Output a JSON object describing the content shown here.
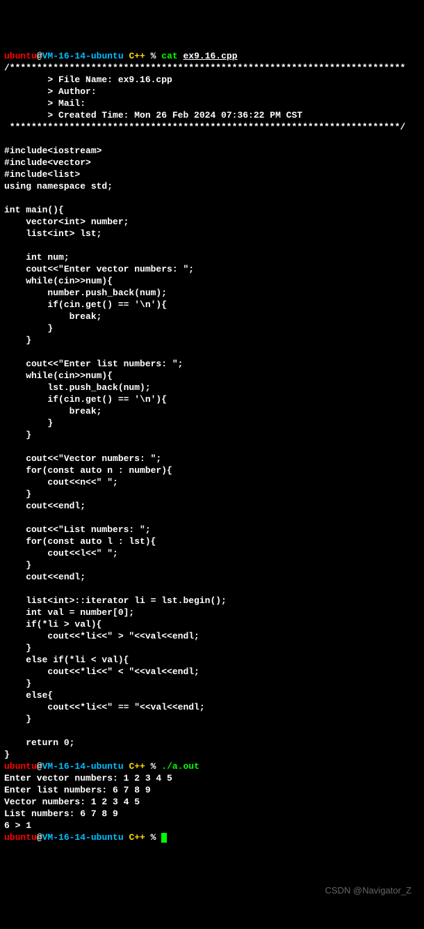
{
  "prompt1": {
    "user": "ubuntu",
    "at": "@",
    "host": "VM-16-14-ubuntu",
    "dir": " C++ ",
    "sym": "% ",
    "cmd": "cat ",
    "arg": "ex9.16.cpp"
  },
  "code": {
    "l01": "/*************************************************************************",
    "l02": "        > File Name: ex9.16.cpp",
    "l03": "        > Author:",
    "l04": "        > Mail:",
    "l05": "        > Created Time: Mon 26 Feb 2024 07:36:22 PM CST",
    "l06": " ************************************************************************/",
    "l07": "",
    "l08": "#include<iostream>",
    "l09": "#include<vector>",
    "l10": "#include<list>",
    "l11": "using namespace std;",
    "l12": "",
    "l13": "int main(){",
    "l14": "    vector<int> number;",
    "l15": "    list<int> lst;",
    "l16": "",
    "l17": "    int num;",
    "l18": "    cout<<\"Enter vector numbers: \";",
    "l19": "    while(cin>>num){",
    "l20": "        number.push_back(num);",
    "l21": "        if(cin.get() == '\\n'){",
    "l22": "            break;",
    "l23": "        }",
    "l24": "    }",
    "l25": "",
    "l26": "    cout<<\"Enter list numbers: \";",
    "l27": "    while(cin>>num){",
    "l28": "        lst.push_back(num);",
    "l29": "        if(cin.get() == '\\n'){",
    "l30": "            break;",
    "l31": "        }",
    "l32": "    }",
    "l33": "",
    "l34": "    cout<<\"Vector numbers: \";",
    "l35": "    for(const auto n : number){",
    "l36": "        cout<<n<<\" \";",
    "l37": "    }",
    "l38": "    cout<<endl;",
    "l39": "",
    "l40": "    cout<<\"List numbers: \";",
    "l41": "    for(const auto l : lst){",
    "l42": "        cout<<l<<\" \";",
    "l43": "    }",
    "l44": "    cout<<endl;",
    "l45": "",
    "l46": "    list<int>::iterator li = lst.begin();",
    "l47": "    int val = number[0];",
    "l48": "    if(*li > val){",
    "l49": "        cout<<*li<<\" > \"<<val<<endl;",
    "l50": "    }",
    "l51": "    else if(*li < val){",
    "l52": "        cout<<*li<<\" < \"<<val<<endl;",
    "l53": "    }",
    "l54": "    else{",
    "l55": "        cout<<*li<<\" == \"<<val<<endl;",
    "l56": "    }",
    "l57": "",
    "l58": "    return 0;",
    "l59": "}"
  },
  "prompt2": {
    "user": "ubuntu",
    "at": "@",
    "host": "VM-16-14-ubuntu",
    "dir": " C++ ",
    "sym": "% ",
    "cmd": "./a.out"
  },
  "output": {
    "o1": "Enter vector numbers: 1 2 3 4 5",
    "o2": "Enter list numbers: 6 7 8 9",
    "o3": "Vector numbers: 1 2 3 4 5",
    "o4": "List numbers: 6 7 8 9",
    "o5": "6 > 1"
  },
  "prompt3": {
    "user": "ubuntu",
    "at": "@",
    "host": "VM-16-14-ubuntu",
    "dir": " C++ ",
    "sym": "% "
  },
  "watermark": "CSDN @Navigator_Z"
}
